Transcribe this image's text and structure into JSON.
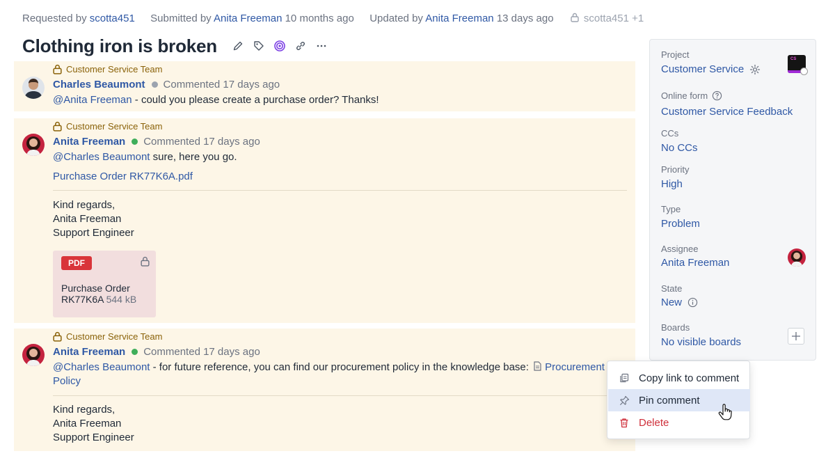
{
  "meta": {
    "requested_prefix": "Requested by",
    "requested_user": "scotta451",
    "submitted_prefix": "Submitted by",
    "submitted_user": "Anita Freeman",
    "submitted_when": "10 months ago",
    "updated_prefix": "Updated by",
    "updated_user": "Anita Freeman",
    "updated_when": "13 days ago",
    "restricted_users": "scotta451 +1"
  },
  "ticket": {
    "title": "Clothing iron is broken",
    "actions": [
      "edit-icon",
      "tag-icon",
      "spiral-icon",
      "link-icon",
      "more-icon"
    ]
  },
  "comments": [
    {
      "team": "Customer Service Team",
      "author": "Charles Beaumont",
      "status_color": "#9ca3af",
      "when": "Commented 17 days ago",
      "mention": "@Anita Freeman",
      "text": " - could you please create a purchase order? Thanks!"
    },
    {
      "team": "Customer Service Team",
      "author": "Anita Freeman",
      "status_color": "#3fae5a",
      "when": "Commented 17 days ago",
      "mention": "@Charles Beaumont",
      "text": " sure, here you go.",
      "attachment_link": "Purchase Order RK77K6A.pdf",
      "signature": [
        "Kind regards,",
        "Anita Freeman",
        "Support Engineer"
      ],
      "pdf": {
        "badge": "PDF",
        "name": "Purchase Order RK77K6A",
        "size": "544 kB"
      }
    },
    {
      "team": "Customer Service Team",
      "author": "Anita Freeman",
      "status_color": "#3fae5a",
      "when": "Commented 17 days ago",
      "mention": "@Charles Beaumont",
      "text": " - for future reference, you can find our procurement policy in the knowledge base: ",
      "kb_link_line1": "Procurement",
      "kb_link_line2": "Policy",
      "signature": [
        "Kind regards,",
        "Anita Freeman",
        "Support Engineer"
      ]
    }
  ],
  "sidebar": {
    "project_label": "Project",
    "project_value": "Customer Service",
    "project_thumb_text": "CS",
    "form_label": "Online form",
    "form_value": "Customer Service Feedback",
    "ccs_label": "CCs",
    "ccs_value": "No CCs",
    "priority_label": "Priority",
    "priority_value": "High",
    "type_label": "Type",
    "type_value": "Problem",
    "assignee_label": "Assignee",
    "assignee_value": "Anita Freeman",
    "state_label": "State",
    "state_value": "New",
    "boards_label": "Boards",
    "boards_value": "No visible boards"
  },
  "context_menu": {
    "items": [
      {
        "label": "Copy link to comment",
        "icon": "copy-icon"
      },
      {
        "label": "Pin comment",
        "icon": "pin-icon",
        "active": true
      },
      {
        "label": "Delete",
        "icon": "trash-icon",
        "danger": true
      }
    ]
  },
  "colors": {
    "accent": "#2f58a5",
    "comment_bg": "#fdf6e7",
    "team_label": "#8a6209",
    "danger": "#cf2f3a"
  }
}
